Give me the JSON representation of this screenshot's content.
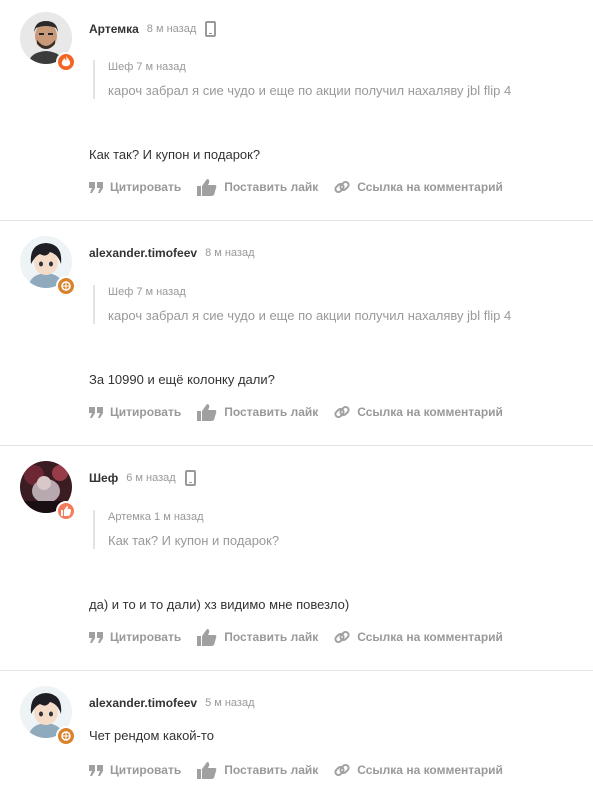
{
  "action_labels": {
    "quote": "Цитировать",
    "like": "Поставить лайк",
    "link": "Ссылка на комментарий"
  },
  "comments": [
    {
      "author": "Артемка",
      "time": "8 м назад",
      "has_device_icon": true,
      "badge_color": "#f26522",
      "quote": {
        "author": "Шеф",
        "time": "7 м назад",
        "text": "кароч забрал я сие чудо и еще по акции получил нахаляву jbl flip 4"
      },
      "text": "Как так? И купон и подарок?"
    },
    {
      "author": "alexander.timofeev",
      "time": "8 м назад",
      "has_device_icon": false,
      "badge_color": "#d9822b",
      "quote": {
        "author": "Шеф",
        "time": "7 м назад",
        "text": "кароч забрал я сие чудо и еще по акции получил нахаляву jbl flip 4"
      },
      "text": "За 10990 и ещё колонку дали?"
    },
    {
      "author": "Шеф",
      "time": "6 м назад",
      "has_device_icon": true,
      "badge_color": "#f47b5a",
      "quote": {
        "author": "Артемка",
        "time": "1 м назад",
        "text": "Как так? И купон и подарок?"
      },
      "text": "да) и то и то дали) хз видимо мне повезло)"
    },
    {
      "author": "alexander.timofeev",
      "time": "5 м назад",
      "has_device_icon": false,
      "badge_color": "#d9822b",
      "quote": null,
      "text": "Чет рендом какой-то"
    }
  ]
}
